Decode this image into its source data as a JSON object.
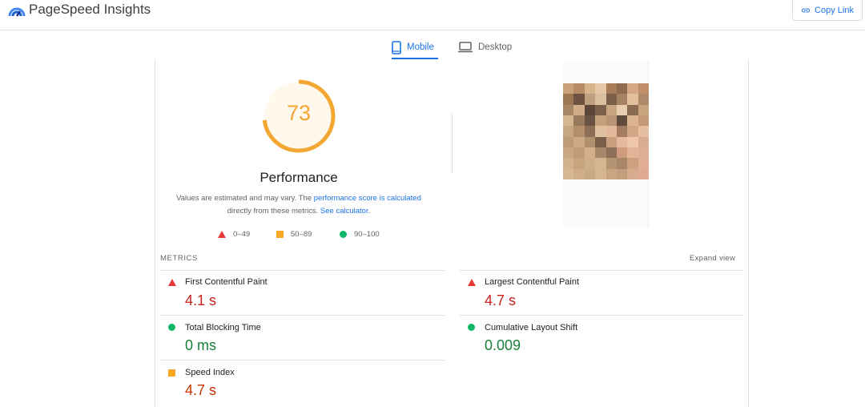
{
  "header": {
    "title": "PageSpeed Insights",
    "copy_link": "Copy Link"
  },
  "tabs": [
    {
      "label": "Mobile",
      "active": true
    },
    {
      "label": "Desktop",
      "active": false
    }
  ],
  "performance": {
    "score": "73",
    "score_value": 73,
    "score_color": "#f2a733",
    "title": "Performance",
    "desc_part1": "Values are estimated and may vary. The ",
    "desc_link1": "performance score is calculated",
    "desc_part2": " directly from these metrics. ",
    "desc_link2": "See calculator",
    "desc_part3": "."
  },
  "legend": [
    {
      "label": "0–49",
      "shape": "triangle",
      "color": "#e53935"
    },
    {
      "label": "50–89",
      "shape": "square",
      "color": "#f9a825"
    },
    {
      "label": "90–100",
      "shape": "circle",
      "color": "#12b76a"
    }
  ],
  "metrics": {
    "heading": "METRICS",
    "expand": "Expand view",
    "items": [
      {
        "name": "First Contentful Paint",
        "value": "4.1 s",
        "status": "fail"
      },
      {
        "name": "Largest Contentful Paint",
        "value": "4.7 s",
        "status": "fail"
      },
      {
        "name": "Total Blocking Time",
        "value": "0 ms",
        "status": "pass"
      },
      {
        "name": "Cumulative Layout Shift",
        "value": "0.009",
        "status": "pass"
      },
      {
        "name": "Speed Index",
        "value": "4.7 s",
        "status": "average"
      }
    ]
  },
  "colors": {
    "accent": "#1a73e8",
    "fail": "#c5221f",
    "pass": "#188038",
    "average": "#c33300"
  }
}
